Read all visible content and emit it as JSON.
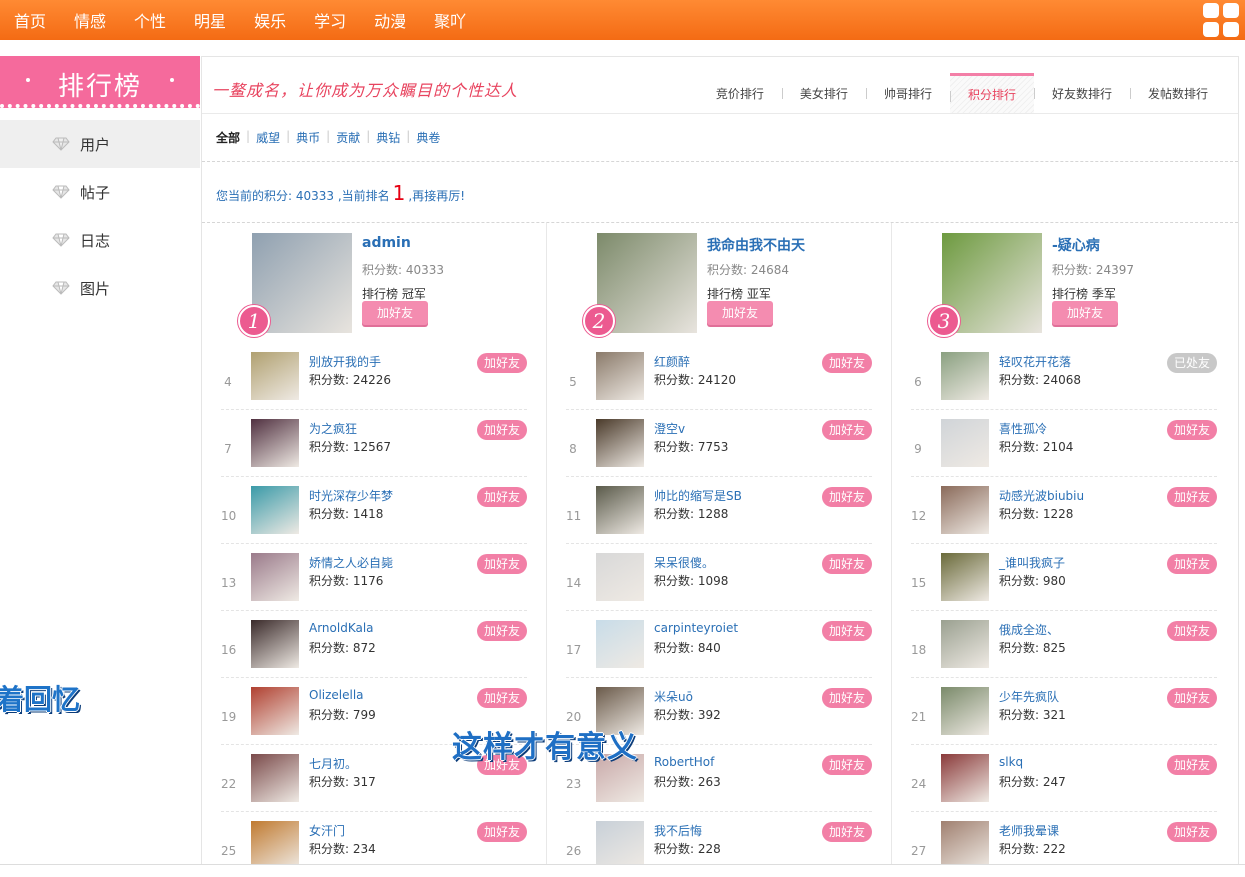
{
  "topnav": {
    "items": [
      "首页",
      "情感",
      "个性",
      "明星",
      "娱乐",
      "学习",
      "动漫",
      "聚吖"
    ],
    "apps_icon": "grid-apps-icon"
  },
  "sidebar": {
    "title": "排行榜",
    "items": [
      "用户",
      "帖子",
      "日志",
      "图片"
    ],
    "item_icon": "diamond-icon",
    "overlay_text": "着回忆"
  },
  "header": {
    "slogan": "一鳌成名，让你成为万众瞩目的个性达人",
    "tabs": [
      "竞价排行",
      "美女排行",
      "帅哥排行",
      "积分排行",
      "好友数排行",
      "发帖数排行"
    ],
    "active_tab": "积分排行"
  },
  "filters": {
    "items": [
      "全部",
      "威望",
      "典币",
      "贡献",
      "典钻",
      "典卷"
    ],
    "active": "全部"
  },
  "status": {
    "prefix": "您当前的积分: 40333 ,当前排名",
    "rank": "1",
    "suffix": ",再接再厉!"
  },
  "top3": [
    {
      "medal": "1",
      "name": "admin",
      "points": "积分数: 40333",
      "title": "排行榜 冠军",
      "button": "加好友",
      "avatar_color": "#8fa0b0"
    },
    {
      "medal": "2",
      "name": "我命由我不由天",
      "points": "积分数: 24684",
      "title": "排行榜 亚军",
      "button": "加好友",
      "avatar_color": "#7c8a6a"
    },
    {
      "medal": "3",
      "name": "-疑心病",
      "points": "积分数: 24397",
      "title": "排行榜 季军",
      "button": "加好友",
      "avatar_color": "#6d9a3f"
    }
  ],
  "ranking": {
    "columns": [
      [
        {
          "rank": "4",
          "name": "别放开我的手",
          "points": "积分数: 24226",
          "button": "加好友",
          "color": "#b0a070"
        },
        {
          "rank": "7",
          "name": "为之疯狂",
          "points": "积分数: 12567",
          "button": "加好友",
          "color": "#503040"
        },
        {
          "rank": "10",
          "name": "时光深存少年梦",
          "points": "积分数: 1418",
          "button": "加好友",
          "color": "#3a9aa8"
        },
        {
          "rank": "13",
          "name": "娇情之人必自毙",
          "points": "积分数: 1176",
          "button": "加好友",
          "color": "#9a7a8a"
        },
        {
          "rank": "16",
          "name": "ArnoldKala",
          "points": "积分数: 872",
          "button": "加好友",
          "color": "#3a2a2a"
        },
        {
          "rank": "19",
          "name": "Olizelella",
          "points": "积分数: 799",
          "button": "加好友",
          "color": "#b04030"
        },
        {
          "rank": "22",
          "name": "七月初。",
          "points": "积分数: 317",
          "button": "加好友",
          "color": "#7a4a4a"
        },
        {
          "rank": "25",
          "name": "女汗门",
          "points": "积分数: 234",
          "button": "加好友",
          "color": "#c07a30"
        }
      ],
      [
        {
          "rank": "5",
          "name": "红颜醉",
          "points": "积分数: 24120",
          "button": "加好友",
          "color": "#8a7a6a"
        },
        {
          "rank": "8",
          "name": "澄空v",
          "points": "积分数: 7753",
          "button": "加好友",
          "color": "#4a3a2a"
        },
        {
          "rank": "11",
          "name": "帅比的缩写是SB",
          "points": "积分数: 1288",
          "button": "加好友",
          "color": "#5a5a4a"
        },
        {
          "rank": "14",
          "name": "呆呆很傻。",
          "points": "积分数: 1098",
          "button": "加好友",
          "color": "#d8d8d8"
        },
        {
          "rank": "17",
          "name": "carpinteyroiet",
          "points": "积分数: 840",
          "button": "加好友",
          "color": "#c8dce8"
        },
        {
          "rank": "20",
          "name": "米朵uō",
          "points": "积分数: 392",
          "button": "加好友",
          "color": "#6a5a4a"
        },
        {
          "rank": "23",
          "name": "RobertHof",
          "points": "积分数: 263",
          "button": "加好友",
          "color": "#c8a8a8"
        },
        {
          "rank": "26",
          "name": "我不后悔",
          "points": "积分数: 228",
          "button": "加好友",
          "color": "#c8d0d8"
        }
      ],
      [
        {
          "rank": "6",
          "name": "轻叹花开花落",
          "points": "积分数: 24068",
          "button": "已处友",
          "done": true,
          "color": "#8aa080"
        },
        {
          "rank": "9",
          "name": "喜性孤冷",
          "points": "积分数: 2104",
          "button": "加好友",
          "color": "#d0d4d8"
        },
        {
          "rank": "12",
          "name": "动感光波biubiu",
          "points": "积分数: 1228",
          "button": "加好友",
          "color": "#8a6a5a"
        },
        {
          "rank": "15",
          "name": "_谁叫我疯子",
          "points": "积分数: 980",
          "button": "加好友",
          "color": "#6a6a3a"
        },
        {
          "rank": "18",
          "name": "俄成全迩、",
          "points": "积分数: 825",
          "button": "加好友",
          "color": "#9aa090"
        },
        {
          "rank": "21",
          "name": "少年先疯队",
          "points": "积分数: 321",
          "button": "加好友",
          "color": "#7a8a6a"
        },
        {
          "rank": "24",
          "name": "slkq",
          "points": "积分数: 247",
          "button": "加好友",
          "color": "#8a3a3a"
        },
        {
          "rank": "27",
          "name": "老师我晕课",
          "points": "积分数: 222",
          "button": "加好友",
          "color": "#a08070"
        }
      ]
    ]
  },
  "overlay": {
    "subtitle": "这样才有意义"
  }
}
